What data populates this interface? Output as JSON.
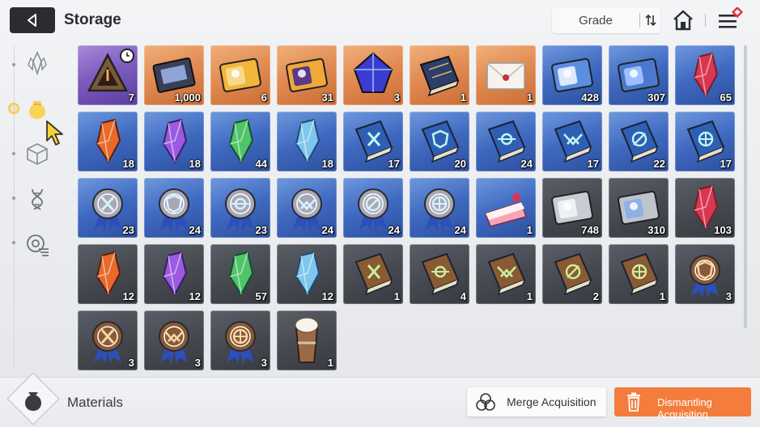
{
  "header": {
    "title": "Storage",
    "sort_label": "Grade"
  },
  "sidebar": {
    "tabs": [
      {
        "id": "crystal",
        "icon": "crystal-icon",
        "active": false
      },
      {
        "id": "materials",
        "icon": "pouch-icon",
        "active": true
      },
      {
        "id": "cube",
        "icon": "cube-icon",
        "active": false
      },
      {
        "id": "dna",
        "icon": "dna-icon",
        "active": false
      },
      {
        "id": "disc",
        "icon": "disc-icon",
        "active": false
      }
    ]
  },
  "grid": {
    "items": [
      {
        "grade": "purple",
        "icon": "triangle-device",
        "count": "7",
        "timer": true
      },
      {
        "grade": "orange",
        "icon": "chip-board",
        "count": "1,000"
      },
      {
        "grade": "orange",
        "icon": "gold-ticket-portrait",
        "count": "6"
      },
      {
        "grade": "orange",
        "icon": "gold-ticket-swirl",
        "count": "31"
      },
      {
        "grade": "orange",
        "icon": "blue-cube-crystal",
        "count": "3"
      },
      {
        "grade": "orange",
        "icon": "map-book",
        "count": "1"
      },
      {
        "grade": "orange",
        "icon": "envelope",
        "count": "1"
      },
      {
        "grade": "blue",
        "icon": "blue-ticket-portrait",
        "count": "428"
      },
      {
        "grade": "blue",
        "icon": "blue-ticket-compass",
        "count": "307"
      },
      {
        "grade": "blue",
        "icon": "crystal-red",
        "count": "65"
      },
      {
        "grade": "blue",
        "icon": "crystal-fire",
        "count": "18"
      },
      {
        "grade": "blue",
        "icon": "crystal-purple",
        "count": "18"
      },
      {
        "grade": "blue",
        "icon": "crystal-green",
        "count": "44"
      },
      {
        "grade": "blue",
        "icon": "crystal-ice",
        "count": "18"
      },
      {
        "grade": "blue",
        "icon": "book-swords",
        "count": "17"
      },
      {
        "grade": "blue",
        "icon": "book-shield",
        "count": "20"
      },
      {
        "grade": "blue",
        "icon": "book-target",
        "count": "24"
      },
      {
        "grade": "blue",
        "icon": "book-wings",
        "count": "17"
      },
      {
        "grade": "blue",
        "icon": "book-crosshair",
        "count": "22"
      },
      {
        "grade": "blue",
        "icon": "book-globe",
        "count": "17"
      },
      {
        "grade": "blue",
        "icon": "medal-swords",
        "count": "23"
      },
      {
        "grade": "blue",
        "icon": "medal-shield",
        "count": "24"
      },
      {
        "grade": "blue",
        "icon": "medal-target",
        "count": "23"
      },
      {
        "grade": "blue",
        "icon": "medal-wings",
        "count": "24"
      },
      {
        "grade": "blue",
        "icon": "medal-crosshair",
        "count": "24"
      },
      {
        "grade": "blue",
        "icon": "medal-globe",
        "count": "24"
      },
      {
        "grade": "blue",
        "icon": "cake-slice",
        "count": "1"
      },
      {
        "grade": "dark",
        "icon": "silver-ticket-portrait",
        "count": "748"
      },
      {
        "grade": "dark",
        "icon": "silver-ticket-compass",
        "count": "310"
      },
      {
        "grade": "dark",
        "icon": "crystal-red",
        "count": "103"
      },
      {
        "grade": "dark",
        "icon": "crystal-fire",
        "count": "12"
      },
      {
        "grade": "dark",
        "icon": "crystal-purple",
        "count": "12"
      },
      {
        "grade": "dark",
        "icon": "crystal-green",
        "count": "57"
      },
      {
        "grade": "dark",
        "icon": "crystal-ice",
        "count": "12"
      },
      {
        "grade": "dark",
        "icon": "brown-book-swords",
        "count": "1"
      },
      {
        "grade": "dark",
        "icon": "brown-book-target",
        "count": "4"
      },
      {
        "grade": "dark",
        "icon": "brown-book-wings",
        "count": "1"
      },
      {
        "grade": "dark",
        "icon": "brown-book-crosshair",
        "count": "2"
      },
      {
        "grade": "dark",
        "icon": "brown-book-globe",
        "count": "1"
      },
      {
        "grade": "dark",
        "icon": "bronze-medal-shield",
        "count": "3"
      },
      {
        "grade": "dark",
        "icon": "bronze-medal-swords",
        "count": "3"
      },
      {
        "grade": "dark",
        "icon": "bronze-medal-wings",
        "count": "3"
      },
      {
        "grade": "dark",
        "icon": "bronze-medal-globe",
        "count": "3"
      },
      {
        "grade": "dark",
        "icon": "frappe-drink",
        "count": "1"
      }
    ]
  },
  "footer": {
    "category_label": "Materials",
    "merge_label": "Merge Acquisition",
    "dismantle_label": "Dismantling Acquisition"
  },
  "colors": {
    "accent_orange": "#f47c3c",
    "grade_purple": "#7d5cc0",
    "grade_orange": "#e08950",
    "grade_blue": "#3f69c0",
    "grade_dark": "#45484f"
  }
}
